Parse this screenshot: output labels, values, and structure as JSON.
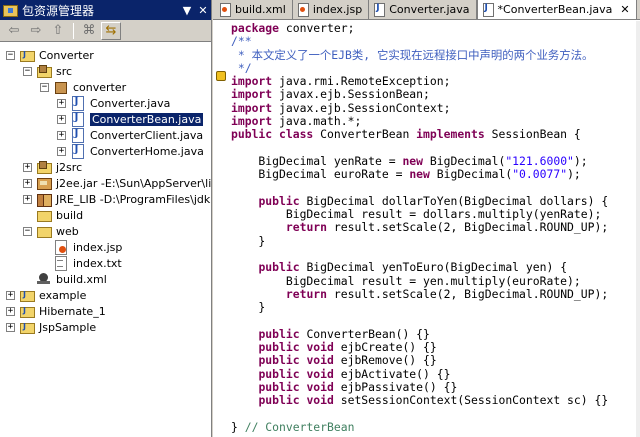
{
  "package_explorer": {
    "title": "包资源管理器",
    "menu_glyph": "▼",
    "close_glyph": "✕",
    "toolbar": {
      "back": "⇦",
      "forward": "⇨",
      "up": "⇧",
      "collapse": "⌘",
      "link": "⇆"
    },
    "tree": [
      {
        "label": "Converter",
        "icon": "project-icon",
        "expand": "−"
      },
      {
        "label": "src",
        "icon": "source-folder-icon",
        "expand": "−"
      },
      {
        "label": "converter",
        "icon": "package-icon",
        "expand": "−"
      },
      {
        "label": "Converter.java",
        "icon": "java-file-icon",
        "expand": "+"
      },
      {
        "label": "ConverterBean.java",
        "icon": "java-file-icon",
        "expand": "+",
        "selected": true
      },
      {
        "label": "ConverterClient.java",
        "icon": "java-file-icon",
        "expand": "+"
      },
      {
        "label": "ConverterHome.java",
        "icon": "java-file-icon",
        "expand": "+"
      },
      {
        "label": "j2src",
        "icon": "source-folder-icon",
        "expand": "+"
      },
      {
        "label": "j2ee.jar -E:\\Sun\\AppServer\\lib",
        "icon": "jar-icon",
        "expand": "+"
      },
      {
        "label": "JRE_LIB -D:\\ProgramFiles\\jdk1",
        "icon": "library-icon",
        "expand": "+"
      },
      {
        "label": "build",
        "icon": "folder-icon",
        "expand": ""
      },
      {
        "label": "web",
        "icon": "folder-icon",
        "expand": "−"
      },
      {
        "label": "index.jsp",
        "icon": "jsp-file-icon",
        "expand": ""
      },
      {
        "label": "index.txt",
        "icon": "text-file-icon",
        "expand": ""
      },
      {
        "label": "build.xml",
        "icon": "ant-file-icon",
        "expand": ""
      },
      {
        "label": "example",
        "icon": "project-icon",
        "expand": "+"
      },
      {
        "label": "Hibernate_1",
        "icon": "project-icon",
        "expand": "+"
      },
      {
        "label": "JspSample",
        "icon": "project-icon",
        "expand": "+"
      }
    ]
  },
  "editor": {
    "tabs": [
      {
        "label": "build.xml",
        "icon": "x"
      },
      {
        "label": "index.jsp",
        "icon": "x"
      },
      {
        "label": "Converter.java",
        "icon": "j"
      },
      {
        "label": "*ConverterBean.java",
        "icon": "j",
        "active": true
      }
    ],
    "tab_close_glyph": "✕",
    "code_lines": [
      [
        [
          "kw",
          "package"
        ],
        [
          "t",
          " converter;"
        ]
      ],
      [
        [
          "cm",
          "/**"
        ]
      ],
      [
        [
          "cm",
          " * 本文定义了一个EJB类, 它实现在远程接口中声明的两个业务方法。"
        ]
      ],
      [
        [
          "cm",
          " */"
        ]
      ],
      [
        [
          "kw",
          "import"
        ],
        [
          "t",
          " java.rmi.RemoteException;"
        ]
      ],
      [
        [
          "kw",
          "import"
        ],
        [
          "t",
          " javax.ejb.SessionBean;"
        ]
      ],
      [
        [
          "kw",
          "import"
        ],
        [
          "t",
          " javax.ejb.SessionContext;"
        ]
      ],
      [
        [
          "kw",
          "import"
        ],
        [
          "t",
          " java.math.*;"
        ]
      ],
      [
        [
          "kw",
          "public class"
        ],
        [
          "t",
          " ConverterBean "
        ],
        [
          "kw",
          "implements"
        ],
        [
          "t",
          " SessionBean {"
        ]
      ],
      [
        [
          "t",
          ""
        ]
      ],
      [
        [
          "t",
          "    BigDecimal yenRate = "
        ],
        [
          "kw",
          "new"
        ],
        [
          "t",
          " BigDecimal("
        ],
        [
          "str",
          "\"121.6000\""
        ],
        [
          "t",
          ");"
        ]
      ],
      [
        [
          "t",
          "    BigDecimal euroRate = "
        ],
        [
          "kw",
          "new"
        ],
        [
          "t",
          " BigDecimal("
        ],
        [
          "str",
          "\"0.0077\""
        ],
        [
          "t",
          ");"
        ]
      ],
      [
        [
          "t",
          ""
        ]
      ],
      [
        [
          "t",
          "    "
        ],
        [
          "kw",
          "public"
        ],
        [
          "t",
          " BigDecimal dollarToYen(BigDecimal dollars) {"
        ]
      ],
      [
        [
          "t",
          "        BigDecimal result = dollars.multiply(yenRate);"
        ]
      ],
      [
        [
          "t",
          "        "
        ],
        [
          "kw",
          "return"
        ],
        [
          "t",
          " result.setScale(2, BigDecimal.ROUND_UP);"
        ]
      ],
      [
        [
          "t",
          "    }"
        ]
      ],
      [
        [
          "t",
          ""
        ]
      ],
      [
        [
          "t",
          "    "
        ],
        [
          "kw",
          "public"
        ],
        [
          "t",
          " BigDecimal yenToEuro(BigDecimal yen) {"
        ]
      ],
      [
        [
          "t",
          "        BigDecimal result = yen.multiply(euroRate);"
        ]
      ],
      [
        [
          "t",
          "        "
        ],
        [
          "kw",
          "return"
        ],
        [
          "t",
          " result.setScale(2, BigDecimal.ROUND_UP);"
        ]
      ],
      [
        [
          "t",
          "    }"
        ]
      ],
      [
        [
          "t",
          ""
        ]
      ],
      [
        [
          "t",
          "    "
        ],
        [
          "kw",
          "public"
        ],
        [
          "t",
          " ConverterBean() {}"
        ]
      ],
      [
        [
          "t",
          "    "
        ],
        [
          "kw",
          "public void"
        ],
        [
          "t",
          " ejbCreate() {}"
        ]
      ],
      [
        [
          "t",
          "    "
        ],
        [
          "kw",
          "public void"
        ],
        [
          "t",
          " ejbRemove() {}"
        ]
      ],
      [
        [
          "t",
          "    "
        ],
        [
          "kw",
          "public void"
        ],
        [
          "t",
          " ejbActivate() {}"
        ]
      ],
      [
        [
          "t",
          "    "
        ],
        [
          "kw",
          "public void"
        ],
        [
          "t",
          " ejbPassivate() {}"
        ]
      ],
      [
        [
          "t",
          "    "
        ],
        [
          "kw",
          "public void"
        ],
        [
          "t",
          " setSessionContext(SessionContext sc) {}"
        ]
      ],
      [
        [
          "t",
          ""
        ]
      ],
      [
        [
          "t",
          "} "
        ],
        [
          "lc",
          "// ConverterBean"
        ]
      ]
    ]
  }
}
